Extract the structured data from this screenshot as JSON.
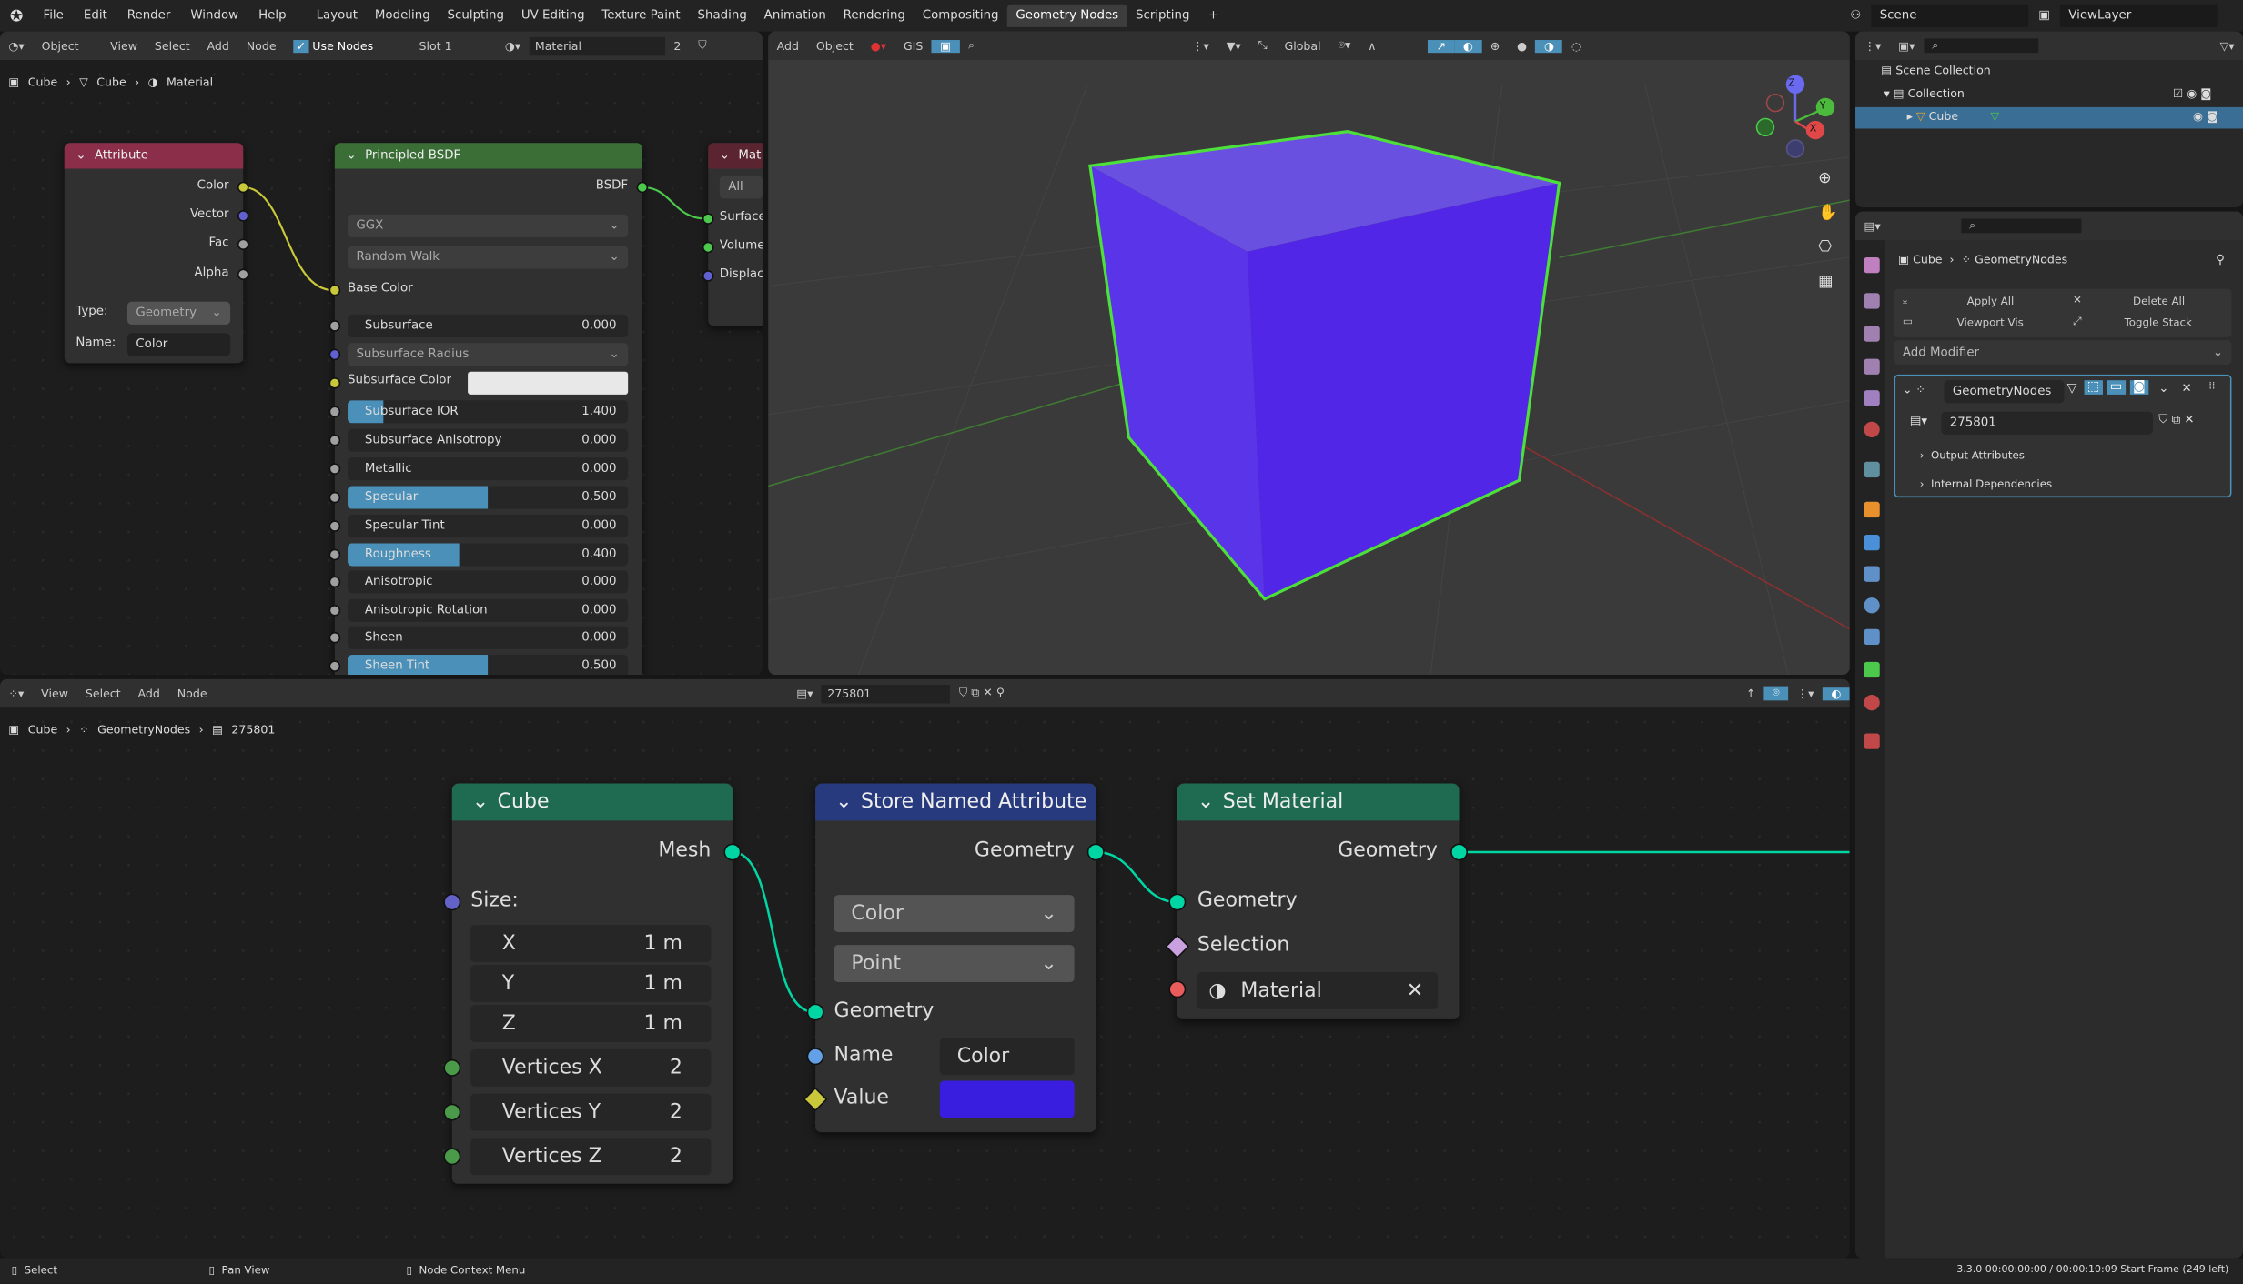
{
  "topbar": {
    "menus": [
      "File",
      "Edit",
      "Render",
      "Window",
      "Help"
    ],
    "workspaces": [
      "Layout",
      "Modeling",
      "Sculpting",
      "UV Editing",
      "Texture Paint",
      "Shading",
      "Animation",
      "Rendering",
      "Compositing",
      "Geometry Nodes",
      "Scripting"
    ],
    "active_workspace": "Geometry Nodes",
    "add_tab": "+",
    "scene": "Scene",
    "view_layer": "ViewLayer"
  },
  "shader_editor": {
    "header": {
      "mode": "Object",
      "menus": [
        "View",
        "Select",
        "Add",
        "Node"
      ],
      "use_nodes": "Use Nodes",
      "use_nodes_checked": true,
      "slot": "Slot 1",
      "material": "Material",
      "users": "2"
    },
    "breadcrumb": [
      "Cube",
      "Cube",
      "Material"
    ],
    "attribute_node": {
      "title": "Attribute",
      "outputs": [
        "Color",
        "Vector",
        "Fac",
        "Alpha"
      ],
      "type_label": "Type:",
      "type_value": "Geometry",
      "name_label": "Name:",
      "name_value": "Color"
    },
    "bsdf_node": {
      "title": "Principled BSDF",
      "output": "BSDF",
      "distribution": "GGX",
      "subsurface_method": "Random Walk",
      "base_color": "Base Color",
      "fields": [
        {
          "label": "Subsurface",
          "value": "0.000",
          "fill": 0
        },
        {
          "label": "Subsurface IOR",
          "value": "1.400",
          "fill": 0.13
        },
        {
          "label": "Subsurface Anisotropy",
          "value": "0.000",
          "fill": 0
        },
        {
          "label": "Metallic",
          "value": "0.000",
          "fill": 0
        },
        {
          "label": "Specular",
          "value": "0.500",
          "fill": 0.5
        },
        {
          "label": "Specular Tint",
          "value": "0.000",
          "fill": 0
        },
        {
          "label": "Roughness",
          "value": "0.400",
          "fill": 0.4
        },
        {
          "label": "Anisotropic",
          "value": "0.000",
          "fill": 0
        },
        {
          "label": "Anisotropic Rotation",
          "value": "0.000",
          "fill": 0
        },
        {
          "label": "Sheen",
          "value": "0.000",
          "fill": 0
        },
        {
          "label": "Sheen Tint",
          "value": "0.500",
          "fill": 0.5
        }
      ],
      "subsurface_radius": "Subsurface Radius",
      "subsurface_color": "Subsurface Color"
    },
    "output_node": {
      "title": "Mat",
      "target": "All",
      "inputs": [
        "Surface",
        "Volume",
        "Displac"
      ]
    }
  },
  "viewport": {
    "header": {
      "menus": [
        "Add",
        "Object"
      ],
      "gis": "GIS",
      "orientation": "Global"
    },
    "gizmo": {
      "x": "X",
      "y": "Y",
      "z": "Z"
    },
    "object_color": "#6a4fe0",
    "outline_color": "#4ee03a"
  },
  "outliner": {
    "items": [
      {
        "label": "Scene Collection"
      },
      {
        "label": "Collection"
      },
      {
        "label": "Cube"
      }
    ]
  },
  "properties": {
    "breadcrumb": [
      "Cube",
      "GeometryNodes"
    ],
    "apply_all": "Apply All",
    "delete_all": "Delete All",
    "viewport_vis": "Viewport Vis",
    "toggle_stack": "Toggle Stack",
    "add_modifier": "Add Modifier",
    "modifier": {
      "name": "GeometryNodes",
      "node_group": "275801",
      "panels": [
        "Output Attributes",
        "Internal Dependencies"
      ]
    }
  },
  "geo_editor": {
    "header": {
      "menus": [
        "View",
        "Select",
        "Add",
        "Node"
      ],
      "node_group": "275801"
    },
    "breadcrumb": [
      "Cube",
      "GeometryNodes",
      "275801"
    ],
    "cube_node": {
      "title": "Cube",
      "output": "Mesh",
      "size_label": "Size:",
      "size": [
        {
          "axis": "X",
          "value": "1 m"
        },
        {
          "axis": "Y",
          "value": "1 m"
        },
        {
          "axis": "Z",
          "value": "1 m"
        }
      ],
      "vertices": [
        {
          "label": "Vertices X",
          "value": "2"
        },
        {
          "label": "Vertices Y",
          "value": "2"
        },
        {
          "label": "Vertices Z",
          "value": "2"
        }
      ]
    },
    "store_node": {
      "title": "Store Named Attribute",
      "output": "Geometry",
      "data_type": "Color",
      "domain": "Point",
      "inputs": {
        "geometry": "Geometry",
        "name": "Name",
        "name_value": "Color",
        "value": "Value"
      },
      "value_color": "#3a1ee0"
    },
    "set_material_node": {
      "title": "Set Material",
      "output": "Geometry",
      "inputs": [
        "Geometry",
        "Selection"
      ],
      "material": "Material"
    }
  },
  "statusbar": {
    "select": "Select",
    "pan": "Pan View",
    "context": "Node Context Menu",
    "info": "3.3.0  00:00:00:00 / 00:00:10:09  Start Frame (249 left)"
  }
}
